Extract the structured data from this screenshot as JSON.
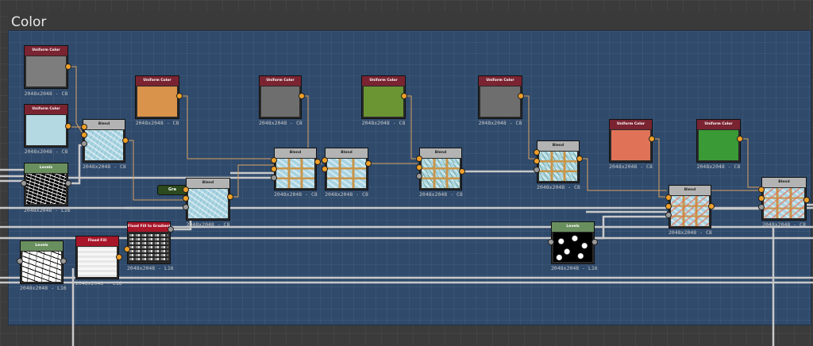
{
  "frame": {
    "title": "Color"
  },
  "labels": {
    "res_c8": "2048x2048 - C8",
    "res_l16": "2048x2048 - L16"
  },
  "nodes": {
    "uniform_color": "Uniform Color",
    "blend": "Blend",
    "levels": "Levels",
    "flood_fill": "Flood Fill",
    "flood_fill_to_gradient": "Flood Fill to Gradient",
    "gra": "Gra"
  },
  "colors": {
    "gray": "#7d7d7d",
    "light_blue": "#b5d9e3",
    "tan": "#d9934a",
    "olive_green": "#6b9433",
    "dark_gray": "#6e6e6e",
    "salmon": "#e07357",
    "green": "#3a9a35",
    "frame_bg": "#2f4a6b",
    "port_orange": "#f0a028",
    "wire": "#bdbdbd"
  }
}
